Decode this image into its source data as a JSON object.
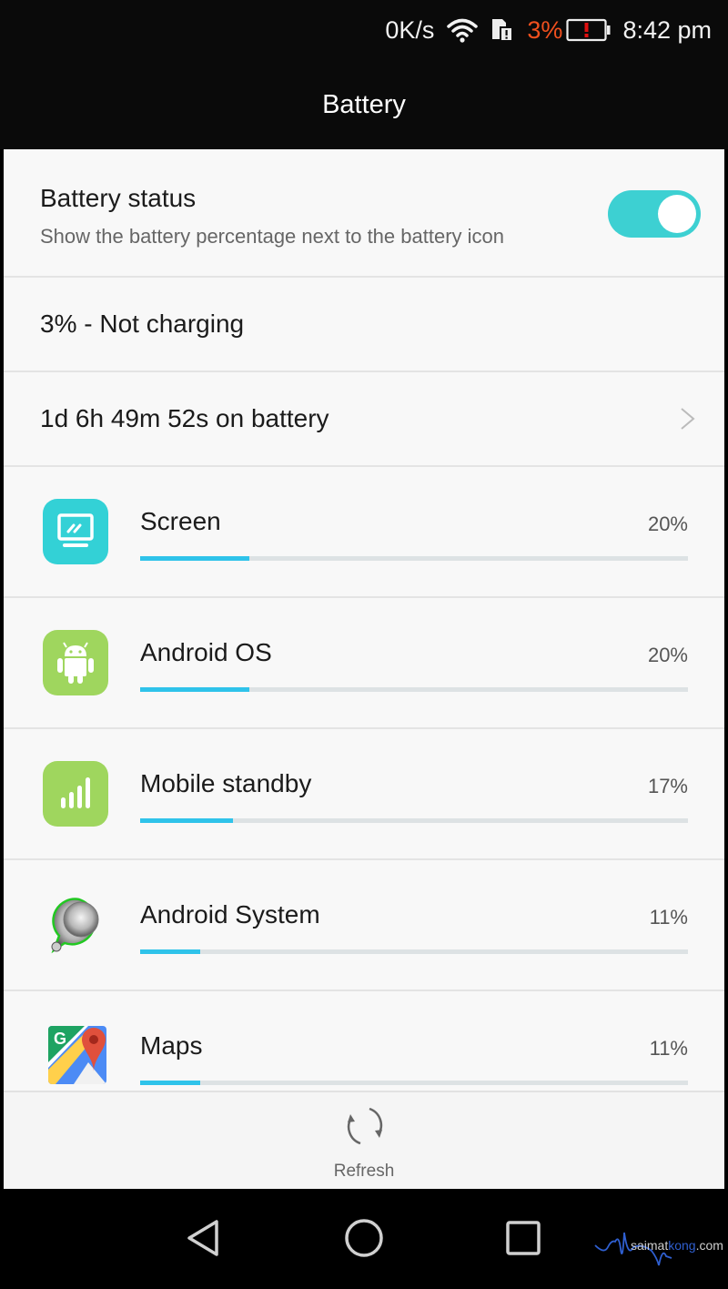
{
  "status_bar": {
    "net_speed": "0K/s",
    "wifi_icon": "wifi-icon",
    "sim_icon": "sim-alert-icon",
    "battery_percent": "3%",
    "battery_icon": "battery-low-alert-icon",
    "time": "8:42 pm"
  },
  "header": {
    "title": "Battery"
  },
  "settings": {
    "battery_status": {
      "title": "Battery status",
      "subtitle": "Show the battery percentage next to the battery icon",
      "toggle_on": true
    },
    "charge_state": "3% - Not charging",
    "on_battery": "1d 6h 49m 52s on battery"
  },
  "usage": [
    {
      "name": "Screen",
      "percent_label": "20%",
      "percent": 20,
      "icon": "screen-icon"
    },
    {
      "name": "Android OS",
      "percent_label": "20%",
      "percent": 20,
      "icon": "android-icon"
    },
    {
      "name": "Mobile standby",
      "percent_label": "17%",
      "percent": 17,
      "icon": "signal-bars-icon"
    },
    {
      "name": "Android System",
      "percent_label": "11%",
      "percent": 11,
      "icon": "android-system-icon"
    },
    {
      "name": "Maps",
      "percent_label": "11%",
      "percent": 11,
      "icon": "maps-icon"
    }
  ],
  "footer": {
    "refresh_label": "Refresh"
  },
  "nav": {
    "back": "back-icon",
    "home": "home-icon",
    "recents": "recents-icon"
  },
  "watermark": {
    "prefix": "saimat",
    "accent": "kong",
    "suffix": ".com"
  },
  "colors": {
    "accent_toggle": "#3dd0d2",
    "bar_fill": "#2fc3ea",
    "battery_alert": "#f0501e"
  }
}
